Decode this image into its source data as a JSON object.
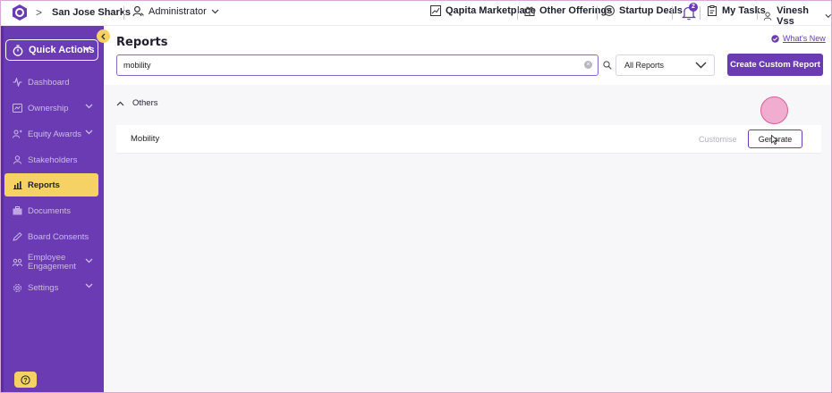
{
  "topbar": {
    "org_name": "San Jose Sharks",
    "role": "Administrator",
    "marketplace": "Qapita Marketplace",
    "other_offerings": "Other Offerings",
    "startup_deals": "Startup Deals",
    "notification_count": "2",
    "my_tasks": "My Tasks",
    "user_name": "Vinesh Vss"
  },
  "sidebar": {
    "quick_actions": "Quick Actions",
    "items": [
      {
        "label": "Dashboard",
        "icon": "pulse-icon"
      },
      {
        "label": "Ownership",
        "icon": "ownership-icon",
        "expandable": true
      },
      {
        "label": "Equity Awards",
        "icon": "equity-awards-icon",
        "expandable": true
      },
      {
        "label": "Stakeholders",
        "icon": "person-icon"
      },
      {
        "label": "Reports",
        "icon": "bar-chart-icon",
        "active": true
      },
      {
        "label": "Documents",
        "icon": "briefcase-icon"
      },
      {
        "label": "Board Consents",
        "icon": "pen-icon"
      },
      {
        "label": "Employee Engagement",
        "icon": "engagement-icon",
        "expandable": true
      },
      {
        "label": "Settings",
        "icon": "gear-icon",
        "expandable": true
      }
    ]
  },
  "main": {
    "title": "Reports",
    "whats_new": "What's New",
    "search_value": "mobility",
    "filter_selected": "All Reports",
    "create_button": "Create Custom Report",
    "section_title": "Others",
    "reports": [
      {
        "name": "Mobility",
        "customise": "Customise",
        "generate": "Generate"
      }
    ]
  },
  "colors": {
    "brand_purple": "#6a3bb3",
    "accent_yellow": "#f6d265",
    "click_indicator": "#ec86b8"
  }
}
